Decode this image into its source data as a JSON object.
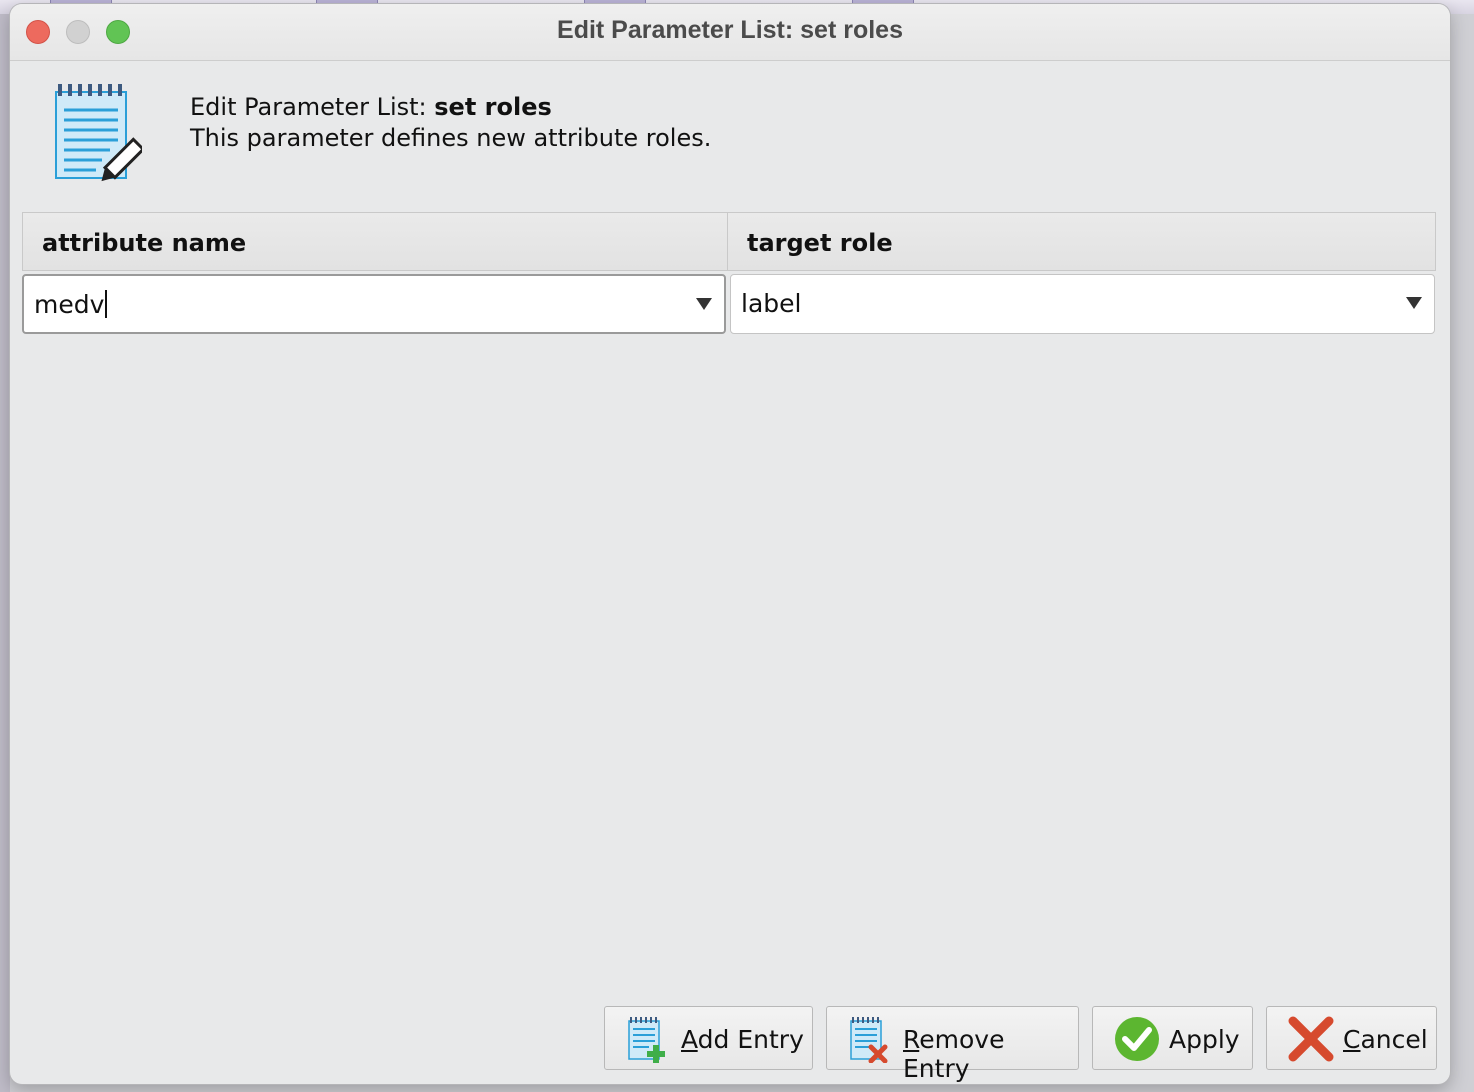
{
  "window": {
    "title": "Edit Parameter List: set roles"
  },
  "header": {
    "icon": "notepad-edit-icon",
    "title_prefix": "Edit Parameter List: ",
    "title_bold": "set roles",
    "description": "This parameter defines new attribute roles."
  },
  "table": {
    "columns": [
      "attribute name",
      "target role"
    ],
    "rows": [
      {
        "attribute_name": "medv",
        "target_role": "label"
      }
    ]
  },
  "buttons": {
    "add": {
      "mnemonic": "A",
      "rest": "dd Entry",
      "icon": "add-entry-icon"
    },
    "remove": {
      "mnemonic": "R",
      "rest": "emove Entry",
      "icon": "remove-entry-icon"
    },
    "apply": {
      "label": "Apply",
      "icon": "check-icon"
    },
    "cancel": {
      "mnemonic": "C",
      "rest": "ancel",
      "icon": "cancel-x-icon"
    }
  },
  "colors": {
    "accent_green": "#5cb630",
    "accent_red": "#d64a2e",
    "icon_blue": "#2a9fd8"
  }
}
